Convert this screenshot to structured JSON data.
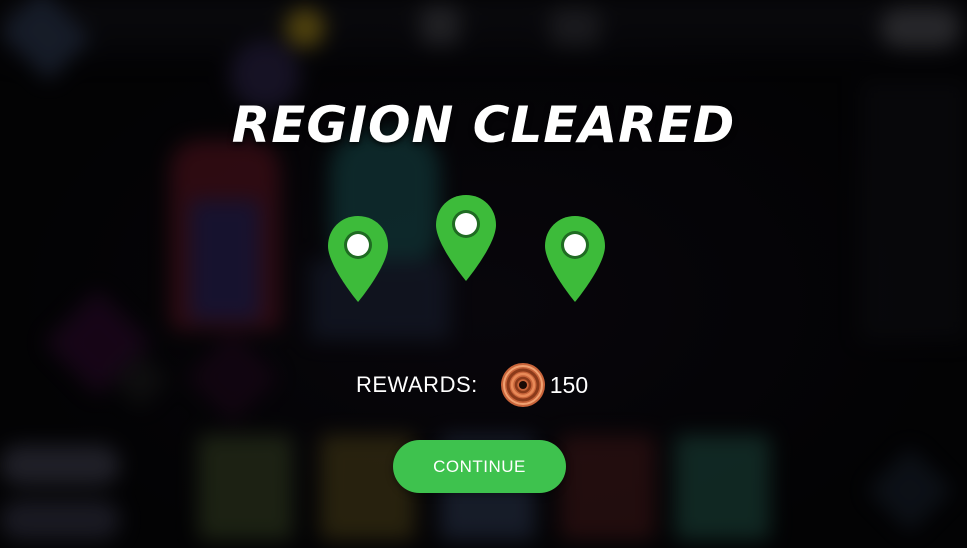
{
  "screen": {
    "title": "REGION CLEARED"
  },
  "pins": [
    {
      "icon": "map-pin-icon",
      "color": "#3dbb3a",
      "cleared": true
    },
    {
      "icon": "map-pin-icon",
      "color": "#3dbb3a",
      "cleared": true
    },
    {
      "icon": "map-pin-icon",
      "color": "#3dbb3a",
      "cleared": true
    }
  ],
  "rewards": {
    "label": "REWARDS:",
    "currency_icon": "copper-coin-icon",
    "amount": "150"
  },
  "continue_button": {
    "label": "CONTINUE",
    "color": "#3ec24e"
  }
}
